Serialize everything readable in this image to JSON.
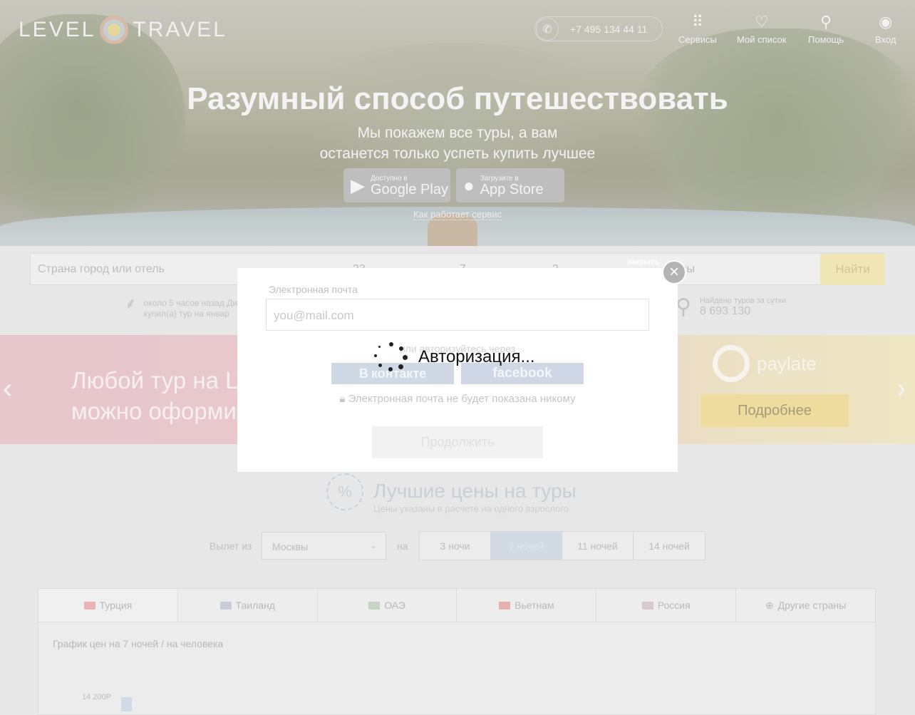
{
  "header": {
    "logo_left": "LEVEL",
    "logo_right": "TRAVEL",
    "phone": "+7 495 134 44 11",
    "nav": [
      {
        "label": "Сервисы",
        "icon": "grid-icon"
      },
      {
        "label": "Мой список",
        "icon": "heart-icon"
      },
      {
        "label": "Помощь",
        "icon": "help-icon"
      },
      {
        "label": "Вход",
        "icon": "user-icon"
      }
    ]
  },
  "hero": {
    "headline": "Разумный способ путешествовать",
    "subline_1": "Мы покажем все туры, а вам",
    "subline_2": "останется только успеть купить лучшее",
    "google_small": "Доступно в",
    "google_big": "Google Play",
    "apple_small": "Загрузите в",
    "apple_big": "App Store",
    "how_link": "Как работает сервис"
  },
  "search": {
    "placeholder": "Страна город или отель",
    "date_hint": "23",
    "nights_hint": "7",
    "tourists_hint": "2",
    "from_hint": "квы",
    "find_label": "Найти"
  },
  "stats": {
    "recent_1": "около 5 часов назад Ди",
    "recent_2": "купил(а) тур на январ",
    "found_label": "Найдено туров за сутки",
    "found_value": "8 693 130"
  },
  "promo": {
    "text_1": "Любой тур на L",
    "text_2": "можно оформи",
    "brand": "paylate",
    "more_label": "Подробнее"
  },
  "prices": {
    "title": "Лучшие цены на туры",
    "subtitle": "Цены указаны в расчете на одного взрослого",
    "fly_from_label": "Вылет из",
    "city": "Москвы",
    "na_label": "на",
    "nights": [
      "3 ночи",
      "7 ночей",
      "11 ночей",
      "14 ночей"
    ],
    "countries": [
      {
        "label": "Турция",
        "flag_color": "#e8b4b4"
      },
      {
        "label": "Таиланд",
        "flag_color": "#c9cdd8"
      },
      {
        "label": "ОАЭ",
        "flag_color": "#c7d3c5"
      },
      {
        "label": "Вьетнам",
        "flag_color": "#e8b0b0"
      },
      {
        "label": "Россия",
        "flag_color": "#d8c9d0"
      },
      {
        "label": "Другие страны",
        "flag_color": "#cccccc"
      }
    ],
    "chart_title": "График цен на 7 ночей / на человека",
    "chart_price": "14 200Р"
  },
  "modal": {
    "close_label": "закрыть",
    "email_label": "Электронная почта",
    "email_placeholder": "you@mail.com",
    "or_text": "или авторизуйтесь через",
    "vk_label": "контакте",
    "fb_label": "facebook",
    "privacy_text": "Электронная почта не будет показана никому",
    "continue_label": "Продолжить",
    "loading_text": "Авторизация..."
  }
}
